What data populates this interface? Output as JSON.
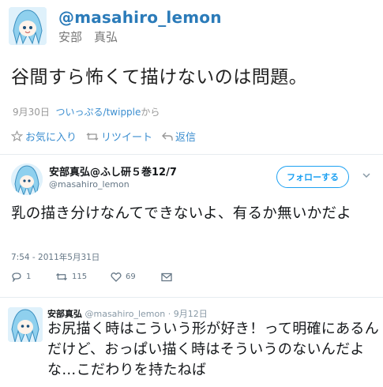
{
  "tweet1": {
    "handle": "@masahiro_lemon",
    "display_name": "安部　真弘",
    "text": "谷間すら怖くて描けないのは問題。",
    "date": "9月30日",
    "via_link": "ついっぷる/twipple",
    "via_suffix": "から",
    "actions": {
      "favorite": "お気に入り",
      "retweet": "リツイート",
      "reply": "返信"
    }
  },
  "tweet2": {
    "display_name": "安部真弘@ふし研５巻12/7",
    "handle": "@masahiro_lemon",
    "follow_label": "フォローする",
    "text": "乳の描き分けなんてできないよ、有るか無いかだよ",
    "timestamp": "7:54 - 2011年5月31日",
    "reply_count": "1",
    "retweet_count": "115",
    "like_count": "69"
  },
  "tweet3": {
    "display_name": "安部真弘",
    "handle_date": "@masahiro_lemon · 9月12日",
    "text": "お尻描く時はこういう形が好き！って明確にあるんだけど、おっぱい描く時はそういうのないんだよな…こだわりを持たねば"
  },
  "icons": [
    "avatar",
    "star-icon",
    "retweet-icon",
    "reply-icon",
    "chevron-down-icon",
    "comment-icon",
    "heart-icon",
    "message-icon"
  ],
  "colors": {
    "link": "#3b8ed0",
    "twitter_blue": "#1da1f2",
    "handle": "#2b7bb9"
  }
}
